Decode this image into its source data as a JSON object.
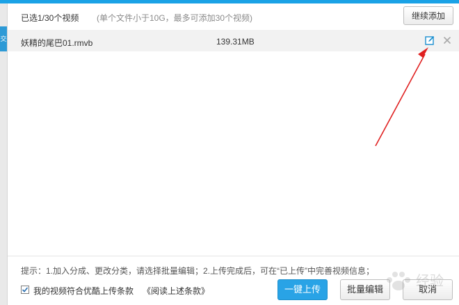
{
  "header": {
    "title": "已选1/30个视频",
    "hint": "(单个文件小于10G，最多可添加30个视频)",
    "continue_add_label": "继续添加"
  },
  "files": [
    {
      "name": "妖精的尾巴01.rmvb",
      "size": "139.31MB"
    }
  ],
  "footer": {
    "tip": "提示：1.加入分成、更改分类，请选择批量编辑；2.上传完成后，可在“已上传”中完善视频信息；",
    "agree_label": "我的视频符合优酷上传条款",
    "terms_link": "《阅读上述条款》",
    "agree_checked": true,
    "upload_label": "一键上传",
    "batch_edit_label": "批量编辑",
    "cancel_label": "取消"
  },
  "left_tab": {
    "label": "交"
  },
  "watermark": {
    "text": "经验"
  },
  "colors": {
    "accent": "#1aa2e6",
    "upload_button": "#29a3e6",
    "annotation_arrow": "#e02020"
  },
  "icons": {
    "edit": "edit-icon",
    "close": "close-icon",
    "checkbox": "checkbox-icon"
  }
}
